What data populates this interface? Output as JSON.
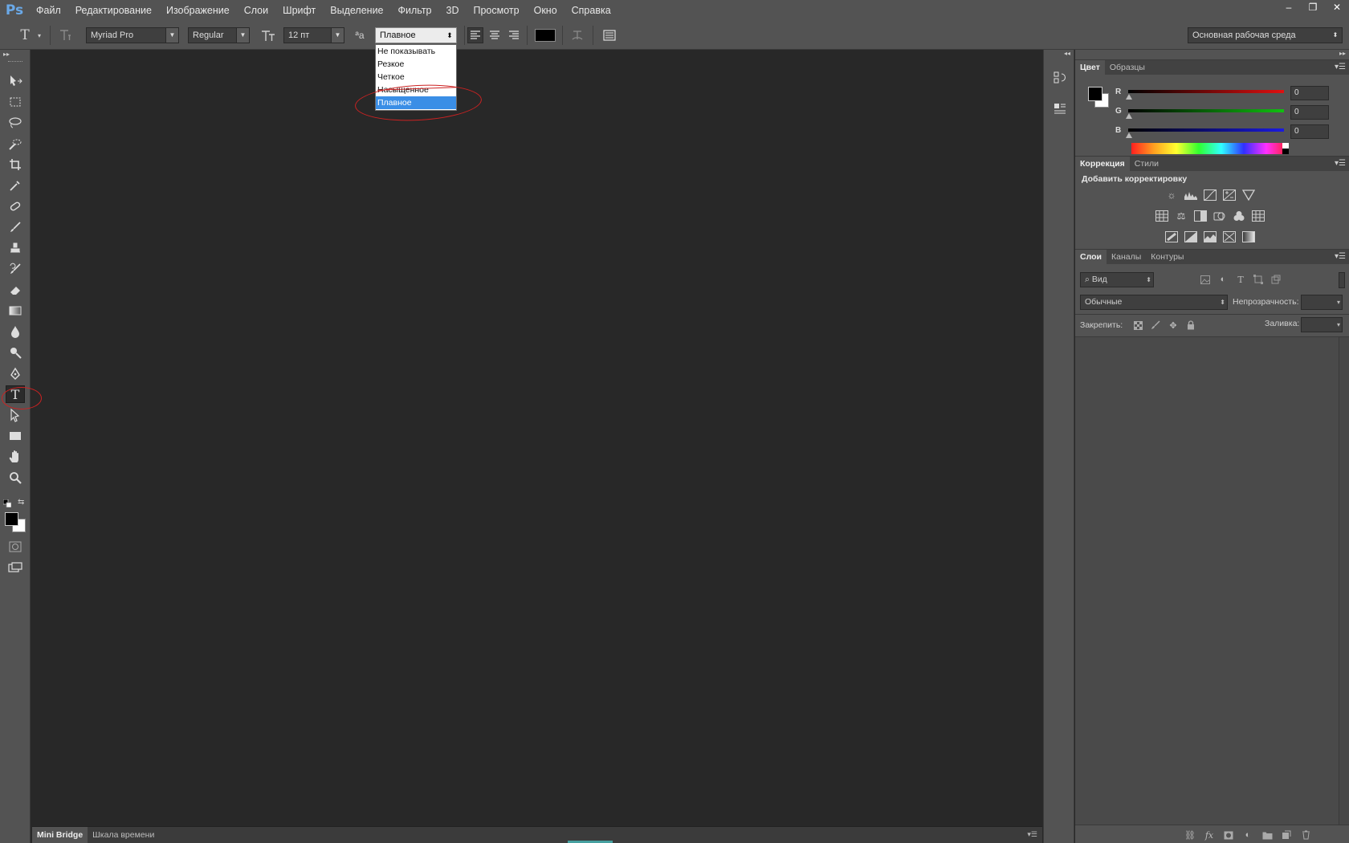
{
  "app": {
    "logo": "Ps"
  },
  "menu": {
    "items": [
      "Файл",
      "Редактирование",
      "Изображение",
      "Слои",
      "Шрифт",
      "Выделение",
      "Фильтр",
      "3D",
      "Просмотр",
      "Окно",
      "Справка"
    ]
  },
  "window_controls": {
    "minimize": "–",
    "restore": "❐",
    "close": "✕"
  },
  "options_bar": {
    "tool_icon": "T",
    "font_family": "Myriad Pro",
    "font_style": "Regular",
    "font_size": "12 пт",
    "aa_label": "ªa",
    "antialias": "Плавное",
    "text_color": "#000000",
    "workspace": "Основная рабочая среда"
  },
  "antialias_dropdown": {
    "options": [
      "Не показывать",
      "Резкое",
      "Четкое",
      "Насыщенное",
      "Плавное"
    ],
    "selected_index": 4
  },
  "toolbar": {
    "header": "▸▸",
    "tools": [
      "move",
      "rect-marquee",
      "lasso",
      "quick-select",
      "crop",
      "eyedropper",
      "healing",
      "brush",
      "stamp",
      "history-brush",
      "eraser",
      "gradient",
      "blur",
      "dodge",
      "pen",
      "type",
      "path-select",
      "rectangle",
      "hand",
      "zoom"
    ],
    "active_tool": "type",
    "foreground": "#000000",
    "background": "#ffffff"
  },
  "color_panel": {
    "tabs": [
      "Цвет",
      "Образцы"
    ],
    "channels": [
      {
        "label": "R",
        "value": "0",
        "color": "#e01010"
      },
      {
        "label": "G",
        "value": "0",
        "color": "#10c010"
      },
      {
        "label": "B",
        "value": "0",
        "color": "#1a1ae0"
      }
    ]
  },
  "adjust_panel": {
    "tabs": [
      "Коррекция",
      "Стили"
    ],
    "title": "Добавить корректировку"
  },
  "layers_panel": {
    "tabs": [
      "Слои",
      "Каналы",
      "Контуры"
    ],
    "filter_kind": "Вид",
    "blend_mode": "Обычные",
    "opacity_label": "Непрозрачность:",
    "lock_label": "Закрепить:",
    "fill_label": "Заливка:"
  },
  "bottom_tabs": [
    "Mini Bridge",
    "Шкала времени"
  ]
}
